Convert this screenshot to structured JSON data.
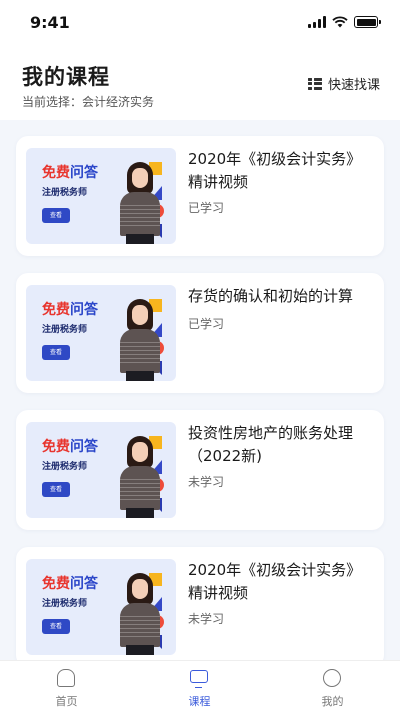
{
  "status_bar": {
    "time": "9:41"
  },
  "header": {
    "title": "我的课程",
    "current_selection": "当前选择：会计经济实务",
    "quick_find_label": "快速找课"
  },
  "thumbnail": {
    "free_red": "免费",
    "free_blue": "问答",
    "subtitle": "注册税务师",
    "button": "查看"
  },
  "courses": [
    {
      "title": "2020年《初级会计实务》精讲视频",
      "status": "已学习"
    },
    {
      "title": "存货的确认和初始的计算",
      "status": "已学习"
    },
    {
      "title": "投资性房地产的账务处理（2022新)",
      "status": "未学习"
    },
    {
      "title": "2020年《初级会计实务》精讲视频",
      "status": "未学习"
    }
  ],
  "tabbar": {
    "items": [
      {
        "label": "首页",
        "icon": "home-icon"
      },
      {
        "label": "课程",
        "icon": "monitor-icon",
        "active": true
      },
      {
        "label": "我的",
        "icon": "user-icon"
      }
    ]
  }
}
